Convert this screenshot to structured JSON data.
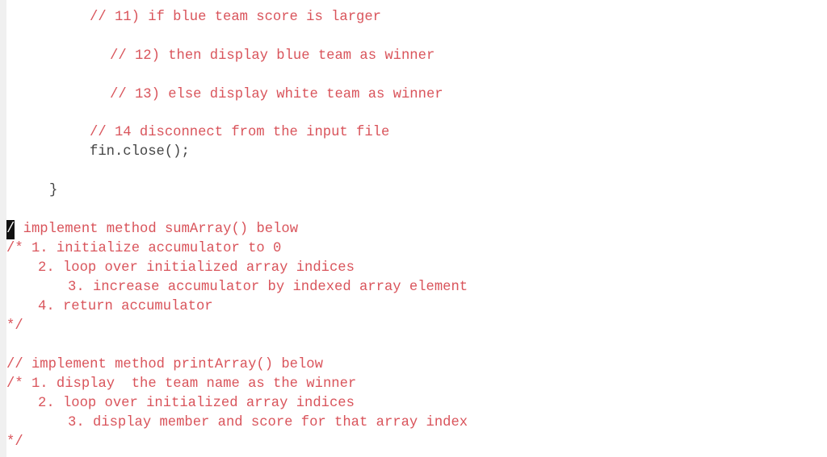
{
  "editor": {
    "lines": [
      {
        "text": "// 11) if blue team score is larger",
        "kind": "comment"
      },
      {
        "text": "// 12) then display blue team as winner",
        "kind": "comment"
      },
      {
        "text": "// 13) else display white team as winner",
        "kind": "comment"
      },
      {
        "text": "// 14 disconnect from the input file",
        "kind": "comment"
      },
      {
        "text": "fin.close();",
        "kind": "code"
      },
      {
        "text": "}",
        "kind": "code"
      },
      {
        "cursor_char": "/",
        "text": "/ implement method sumArray() below",
        "kind": "comment"
      },
      {
        "text": "/* 1. initialize accumulator to 0",
        "kind": "comment"
      },
      {
        "text": "2. loop over initialized array indices",
        "kind": "comment"
      },
      {
        "text": "3. increase accumulator by indexed array element",
        "kind": "comment"
      },
      {
        "text": "4. return accumulator",
        "kind": "comment"
      },
      {
        "text": "*/",
        "kind": "comment"
      },
      {
        "text": "// implement method printArray() below",
        "kind": "comment"
      },
      {
        "text": "/* 1. display  the team name as the winner",
        "kind": "comment"
      },
      {
        "text": "2. loop over initialized array indices",
        "kind": "comment"
      },
      {
        "text": "3. display member and score for that array index",
        "kind": "comment"
      },
      {
        "text": "*/",
        "kind": "comment"
      }
    ]
  },
  "colors": {
    "comment": "#d9545b",
    "code": "#444444",
    "gutter": "#f0f0f0"
  }
}
